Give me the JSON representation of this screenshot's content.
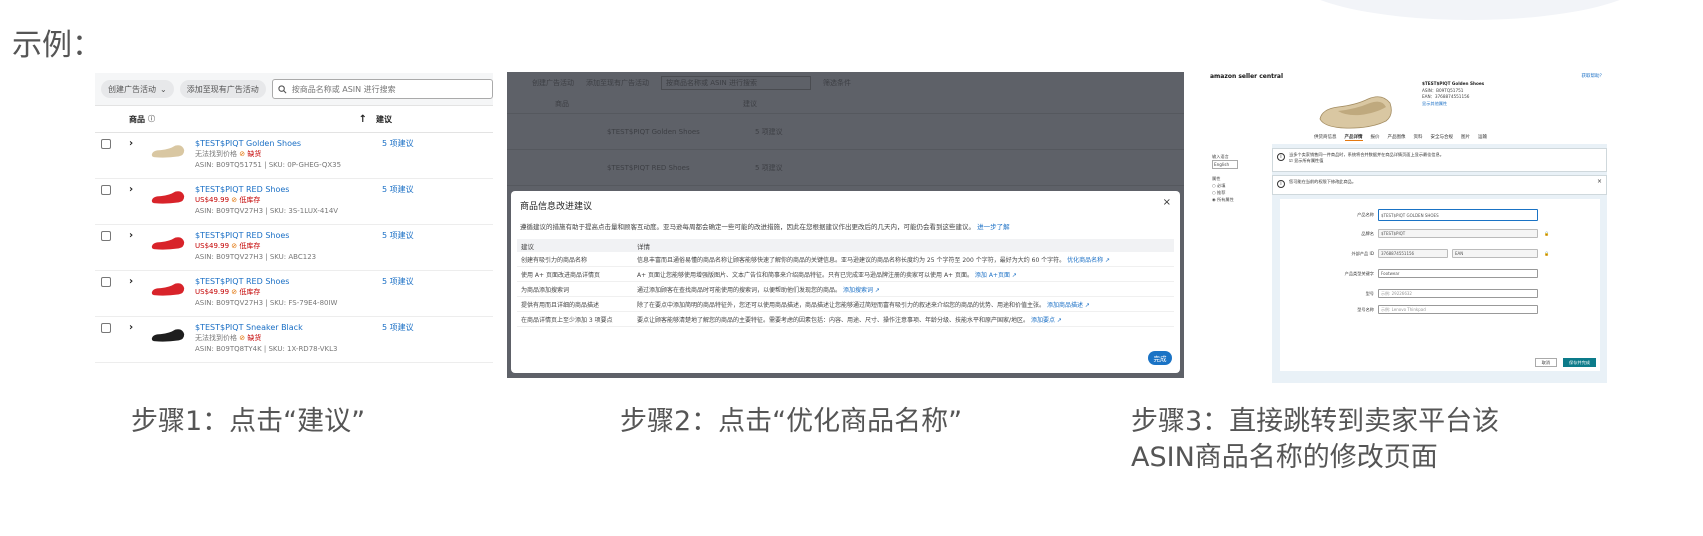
{
  "heading": "示例：",
  "panel1": {
    "create_btn": "创建广告活动",
    "add_btn": "添加至现有广告活动",
    "search_placeholder": "按商品名称或 ASIN 进行搜索",
    "col_product": "商品",
    "col_suggest": "建议",
    "rows": [
      {
        "name": "$TEST$PIQT Golden Shoes",
        "price": "无法找到价格",
        "stock": "缺货",
        "meta": "ASIN: B09TQ51751 | SKU: 0P-GHEG-QX35",
        "suggest": "5 项建议"
      },
      {
        "name": "$TEST$PIQT RED Shoes",
        "price": "US$49.99",
        "stock": "低库存",
        "meta": "ASIN: B09TQV27H3 | SKU: 3S-1LUX-414V",
        "suggest": "5 项建议"
      },
      {
        "name": "$TEST$PIQT RED Shoes",
        "price": "US$49.99",
        "stock": "低库存",
        "meta": "ASIN: B09TQV27H3 | SKU: ABC123",
        "suggest": "5 项建议"
      },
      {
        "name": "$TEST$PIQT RED Shoes",
        "price": "US$49.99",
        "stock": "低库存",
        "meta": "ASIN: B09TQV27H3 | SKU: FS-79E4-80IW",
        "suggest": "5 项建议"
      },
      {
        "name": "$TEST$PIQT Sneaker Black",
        "price": "无法找到价格",
        "stock": "缺货",
        "meta": "ASIN: B09TQ8TY4K | SKU: 1X-RD78-VKL3",
        "suggest": "5 项建议"
      }
    ]
  },
  "panel2": {
    "bg_create": "创建广告活动",
    "bg_add": "添加至现有广告活动",
    "bg_search": "按商品名称或 ASIN 进行搜索",
    "bg_filter": "筛选条件",
    "bg_col_product": "商品",
    "bg_col_suggest": "建议",
    "bg_row1": "$TEST$PIQT Golden Shoes",
    "bg_row2": "$TEST$PIQT RED Shoes",
    "bg_suggest": "5 项建议",
    "modal_title": "商品信息改进建议",
    "close": "×",
    "modal_desc": "遵循建议的措施有助于提高点击量和顾客互动度。亚马逊每周都会确定一些可能的改进措施，因此在您根据建议作出更改后的几天内，可能仍会看到这些建议。",
    "learn_more": "进一步了解",
    "th_suggest": "建议",
    "th_detail": "详情",
    "rows": [
      {
        "s": "创建有吸引力的商品名称",
        "d": "信息丰富而且通俗易懂的商品名称让顾客能够快速了解你的商品的关键信息。亚马逊建议的商品名称长度约为 25 个字符至 200 个字符，最好为大约 60 个字符。",
        "link": "优化商品名称"
      },
      {
        "s": "使用 A+ 页面改进商品详情页",
        "d": "A+ 页面让您能够使用增强版图片、文本广告位和简事来介绍商品特征。只有已完成亚马逊品牌注册的卖家可以使用 A+ 页面。",
        "link": "添加 A+页面"
      },
      {
        "s": "为商品添加搜索词",
        "d": "通过添加顾客在查找商品时可能使用的搜索词，以便帮助他们发现您的商品。",
        "link": "添加搜索词"
      },
      {
        "s": "提供有用而且详细的商品描述",
        "d": "除了在要点中添加简明的商品特征外，您还可以使用商品描述，商品描述让您能够通过简短而富有吸引力的叙述来介绍您的商品的优势、用途和价值主张。",
        "link": "添加商品描述"
      },
      {
        "s": "在商品详情页上至少添加 3 项要点",
        "d": "要点让顾客能够清楚地了解您的商品的主要特征。需要考虑的因素包括：内容、用途、尺寸、操作注意事项、年龄分级、技能水平和原产国家/地区。",
        "link": "添加要点"
      }
    ],
    "done": "完成"
  },
  "panel3": {
    "logo": "amazon seller central",
    "help": "获取帮助？",
    "prod_title": "$TEST$PIQT Golden Shoes",
    "prod_asin": "ASIN：B09TQ51751",
    "prod_ean": "EAN：3768874551156",
    "prod_more": "显示其他属性",
    "tabs": [
      "供货商信息",
      "产品详情",
      "报价",
      "产品图像",
      "资料",
      "安全与合规",
      "图片",
      "运输"
    ],
    "lang_label": "输入语言",
    "lang_value": "English",
    "filter_label": "属性",
    "filter_opts": [
      "必填",
      "推荐",
      "所有属性"
    ],
    "notice1": "当多个卖家销售同一件商品时，系统将合并数据并在商品详情页面上显示最佳信息。",
    "notice1_chk": "显示所有属性值",
    "notice2": "您可能在当前的权限下修改此商品。",
    "fields": {
      "title_label": "产品名称",
      "title_value": "$TEST$PIQT GOLDEN SHOES",
      "brand_label": "品牌名",
      "brand_value": "$TEST$PIQT",
      "id_label": "外部产品 ID",
      "id_value": "3768874551156",
      "id_type": "EAN",
      "kw_label": "产品类型关键字",
      "kw_value": "Footwear",
      "model_label": "型号",
      "model_value": "示例: 29226632",
      "mfr_label": "型号名称",
      "mfr_value": "示例: Lenovo Thinkpad"
    },
    "cancel": "取消",
    "save": "保存并完成"
  },
  "captions": {
    "step1": "步骤1：点击“建议”",
    "step2": "步骤2：点击“优化商品名称”",
    "step3_line1": "步骤3：直接跳转到卖家平台该",
    "step3_line2": "ASIN商品名称的修改页面"
  },
  "colors": {
    "link": "#1a6fc5",
    "error_red": "#c40000",
    "modal_overlay": "#5e6168",
    "primary_button": "#1a73c5",
    "save_button": "#0c7b8a"
  }
}
